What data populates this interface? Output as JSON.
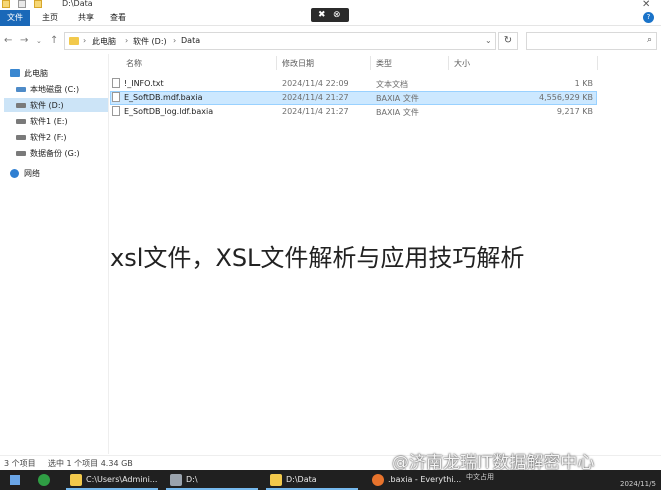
{
  "window": {
    "title": "D:\\Data",
    "overlay_left_glyph": "✖",
    "overlay_right_glyph": "⊗"
  },
  "ribbon": {
    "tabs": [
      "文件",
      "主页",
      "共享",
      "查看"
    ],
    "help": "?"
  },
  "address": {
    "crumbs": [
      "此电脑",
      "软件 (D:)",
      "Data"
    ],
    "search_placeholder": ""
  },
  "sidebar": {
    "items": [
      {
        "label": "此电脑",
        "icon": "computer-icon"
      },
      {
        "label": "本地磁盘 (C:)",
        "icon": "system-drive-icon"
      },
      {
        "label": "软件 (D:)",
        "icon": "drive-icon",
        "selected": true
      },
      {
        "label": "软件1 (E:)",
        "icon": "drive-icon"
      },
      {
        "label": "软件2 (F:)",
        "icon": "drive-icon"
      },
      {
        "label": "数据备份 (G:)",
        "icon": "drive-icon"
      },
      {
        "label": "网络",
        "icon": "network-icon"
      }
    ]
  },
  "columns": {
    "name": "名称",
    "modified": "修改日期",
    "type": "类型",
    "size": "大小"
  },
  "files": [
    {
      "name": "!_INFO.txt",
      "modified": "2024/11/4 22:09",
      "type": "文本文档",
      "size": "1 KB",
      "selected": false
    },
    {
      "name": "E_SoftDB.mdf.baxia",
      "modified": "2024/11/4 21:27",
      "type": "BAXIA 文件",
      "size": "4,556,929 KB",
      "selected": true
    },
    {
      "name": "E_SoftDB_log.ldf.baxia",
      "modified": "2024/11/4 21:27",
      "type": "BAXIA 文件",
      "size": "9,217 KB",
      "selected": false
    }
  ],
  "article_title": "xsl文件，XSL文件解析与应用技巧解析",
  "status": {
    "count": "3 个项目",
    "selected": "选中 1 个项目  4.34 GB"
  },
  "taskbar": {
    "items": [
      {
        "label": "C:\\Users\\Admini..."
      },
      {
        "label": "D:\\"
      },
      {
        "label": "D:\\Data"
      },
      {
        "label": ".baxia - Everythi..."
      }
    ],
    "corner_watermark": "@济南龙瑞IT数据解密中心",
    "tray_top": "中文占用",
    "time": "2024/11/5"
  },
  "colors": {
    "accent": "#1a68b8",
    "selection": "#cce8ff",
    "taskbar": "#202020"
  }
}
